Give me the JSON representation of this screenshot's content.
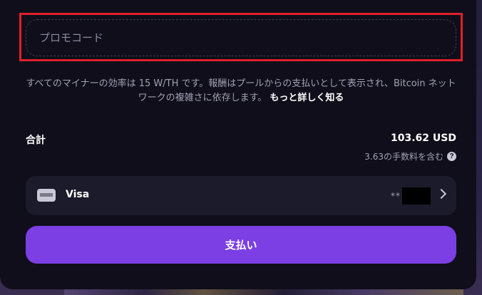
{
  "promo": {
    "placeholder": "プロモコード",
    "value": ""
  },
  "info": {
    "text": "すべてのマイナーの効率は 15 W/TH です。報酬はプールからの支払いとして表示され、Bitcoin ネットワークの複雑さに依存します。",
    "link_label": "もっと詳しく知る"
  },
  "summary": {
    "total_label": "合計",
    "total_value": "103.62 USD",
    "fee_text": "3.63の手数料を含む",
    "help_icon": "?"
  },
  "payment_method": {
    "icon": "credit-card-icon",
    "name": "Visa",
    "masked_number": "**"
  },
  "pay_button": {
    "label": "支払い"
  },
  "colors": {
    "panel_background": "#0f0e1a",
    "accent": "#7b3fe4",
    "highlight_border": "#e0202a",
    "muted_text": "#a2a1b4"
  }
}
